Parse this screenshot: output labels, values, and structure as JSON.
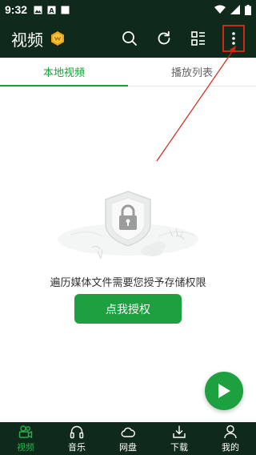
{
  "status_bar": {
    "time": "9:32"
  },
  "header": {
    "title": "视频",
    "vip_badge_icon": "vip-crown-icon",
    "actions": [
      "search-icon",
      "refresh-icon",
      "layout-icon",
      "more-vert-icon"
    ]
  },
  "tabs": [
    {
      "label": "本地视频",
      "active": true
    },
    {
      "label": "播放列表",
      "active": false
    }
  ],
  "empty_state": {
    "message": "遍历媒体文件需要您授予存储权限",
    "button_label": "点我授权"
  },
  "bottom_nav": [
    {
      "label": "视频",
      "icon": "video-icon",
      "active": true
    },
    {
      "label": "音乐",
      "icon": "headphones-icon",
      "active": false
    },
    {
      "label": "网盘",
      "icon": "cloud-icon",
      "active": false
    },
    {
      "label": "下载",
      "icon": "download-icon",
      "active": false
    },
    {
      "label": "我的",
      "icon": "user-icon",
      "active": false
    }
  ],
  "colors": {
    "header_bg": "#0f2a1a",
    "accent": "#1ca040",
    "annotation": "#d0281a"
  }
}
